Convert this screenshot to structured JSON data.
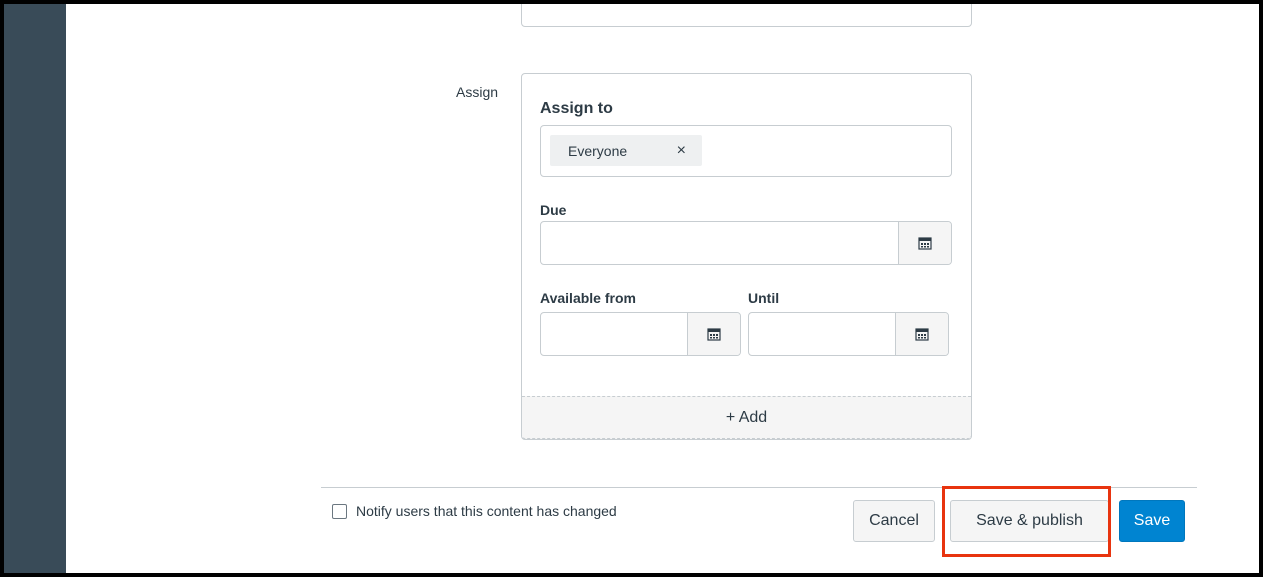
{
  "assign": {
    "label": "Assign",
    "assign_to_title": "Assign to",
    "assignee_chip": "Everyone",
    "remove_symbol": "×",
    "due_label": "Due",
    "due_value": "",
    "available_from_label": "Available from",
    "available_from_value": "",
    "until_label": "Until",
    "until_value": "",
    "add_label": "+ Add"
  },
  "footer": {
    "notify_label": "Notify users that this content has changed",
    "notify_checked": false,
    "cancel_label": "Cancel",
    "save_publish_label": "Save & publish",
    "save_label": "Save"
  },
  "colors": {
    "sidebar": "#394b58",
    "primary": "#0084d1",
    "highlight": "#e8340f",
    "text": "#2d3b45"
  },
  "icons": {
    "calendar": "calendar-icon",
    "close": "close-icon",
    "plus": "plus-icon",
    "checkbox": "checkbox-icon"
  }
}
